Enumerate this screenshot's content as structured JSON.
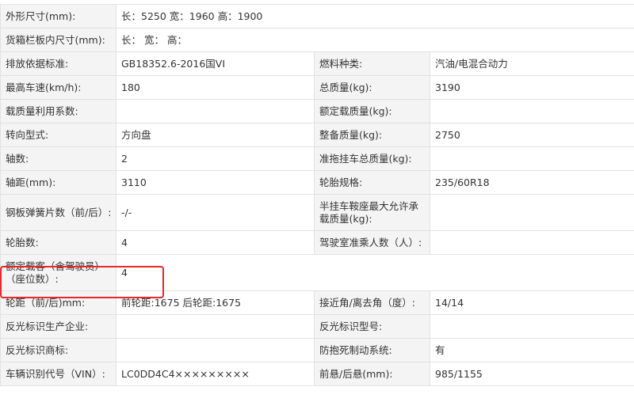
{
  "rows": [
    {
      "l1": "外形尺寸(mm):",
      "v1": "长：5250 宽：1960 高：1900"
    },
    {
      "l1": "货箱栏板内尺寸(mm):",
      "v1": "长： 宽： 高："
    },
    {
      "l1": "排放依据标准:",
      "v1": "GB18352.6-2016国VI",
      "l2": "燃料种类:",
      "v2": "汽油/电混合动力"
    },
    {
      "l1": "最高车速(km/h):",
      "v1": "180",
      "l2": "总质量(kg):",
      "v2": "3190"
    },
    {
      "l1": "载质量利用系数:",
      "v1": "",
      "l2": "额定载质量(kg):",
      "v2": ""
    },
    {
      "l1": "转向型式:",
      "v1": "方向盘",
      "l2": "整备质量(kg):",
      "v2": "2750"
    },
    {
      "l1": "轴数:",
      "v1": "2",
      "l2": "准拖挂车总质量(kg):",
      "v2": ""
    },
    {
      "l1": "轴距(mm):",
      "v1": "3110",
      "l2": "轮胎规格:",
      "v2": "235/60R18"
    },
    {
      "l1": "钢板弹簧片数（前/后）:",
      "v1": "-/-",
      "l2": "半挂车鞍座最大允许承载质量(kg):",
      "v2": ""
    },
    {
      "l1": "轮胎数:",
      "v1": "4",
      "l2": "驾驶室准乘人数（人）:",
      "v2": ""
    },
    {
      "l1": "额定载客（含驾驶员）（座位数）:",
      "v1": "4"
    },
    {
      "l1": "轮距（前/后)mm:",
      "v1": "前轮距:1675 后轮距:1675",
      "l2": "接近角/离去角（度）:",
      "v2": "14/14"
    },
    {
      "l1": "反光标识生产企业:",
      "v1": "",
      "l2": "反光标识型号:",
      "v2": ""
    },
    {
      "l1": "反光标识商标:",
      "v1": "",
      "l2": "防抱死制动系统:",
      "v2": "有"
    },
    {
      "l1": "车辆识别代号（VIN）:",
      "v1": "LC0DD4C4×××××××××",
      "l2": "前悬/后悬(mm):",
      "v2": "985/1155"
    }
  ],
  "colors": {
    "label_bg": "#f4f4f4",
    "border": "#e1e1e1",
    "text": "#333333",
    "highlight": "#e8262e"
  }
}
